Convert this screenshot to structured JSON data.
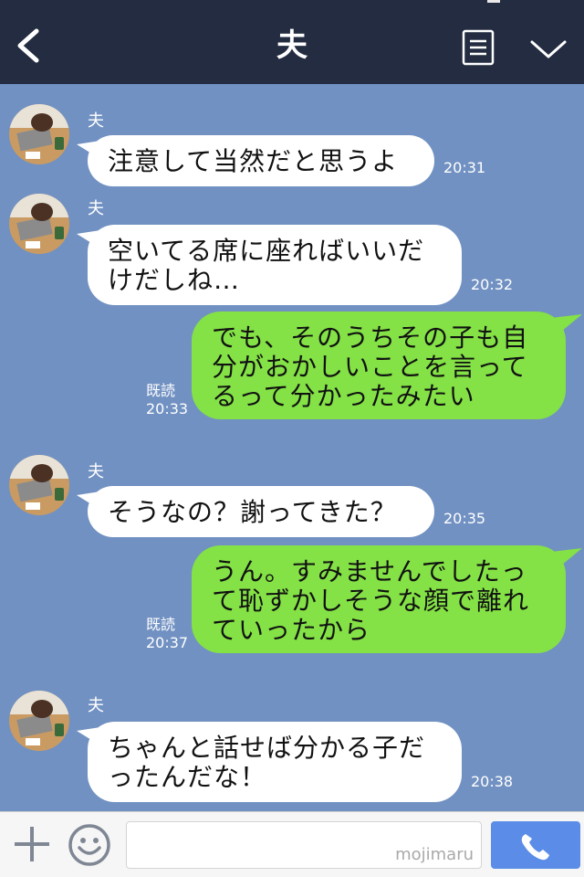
{
  "header": {
    "title": "夫",
    "back_icon": "chevron-left-icon",
    "notes_icon": "notes-icon",
    "menu_icon": "chevron-down-icon"
  },
  "chat": {
    "messages": [
      {
        "side": "in",
        "sender": "夫",
        "lines": [
          "注意して当然だと思うよ"
        ],
        "time": "20:31"
      },
      {
        "side": "in",
        "sender": "夫",
        "lines": [
          "空いてる席に座ればいいだ",
          "けだしね…"
        ],
        "time": "20:32"
      },
      {
        "side": "out",
        "read": "既読",
        "lines": [
          "でも、そのうちその子も自",
          "分がおかしいことを言って",
          "るって分かったみたい"
        ],
        "time": "20:33"
      },
      {
        "side": "in",
        "sender": "夫",
        "lines": [
          "そうなの？謝ってきた？"
        ],
        "time": "20:35"
      },
      {
        "side": "out",
        "read": "既読",
        "lines": [
          "うん。すみませんでしたっ",
          "て恥ずかしそうな顔で離れ",
          "ていったから"
        ],
        "time": "20:37"
      },
      {
        "side": "in",
        "sender": "夫",
        "lines": [
          "ちゃんと話せば分かる子だ",
          "ったんだな！"
        ],
        "time": "20:38"
      }
    ]
  },
  "footer": {
    "plus_icon": "plus-icon",
    "sticker_icon": "smiley-icon",
    "input_placeholder": "",
    "watermark": "mojimaru",
    "call_icon": "phone-icon"
  },
  "colors": {
    "header_bg": "#232c40",
    "chat_bg": "#7191c2",
    "incoming_bubble": "#ffffff",
    "outgoing_bubble": "#84e146",
    "send_button": "#5b8de8"
  }
}
